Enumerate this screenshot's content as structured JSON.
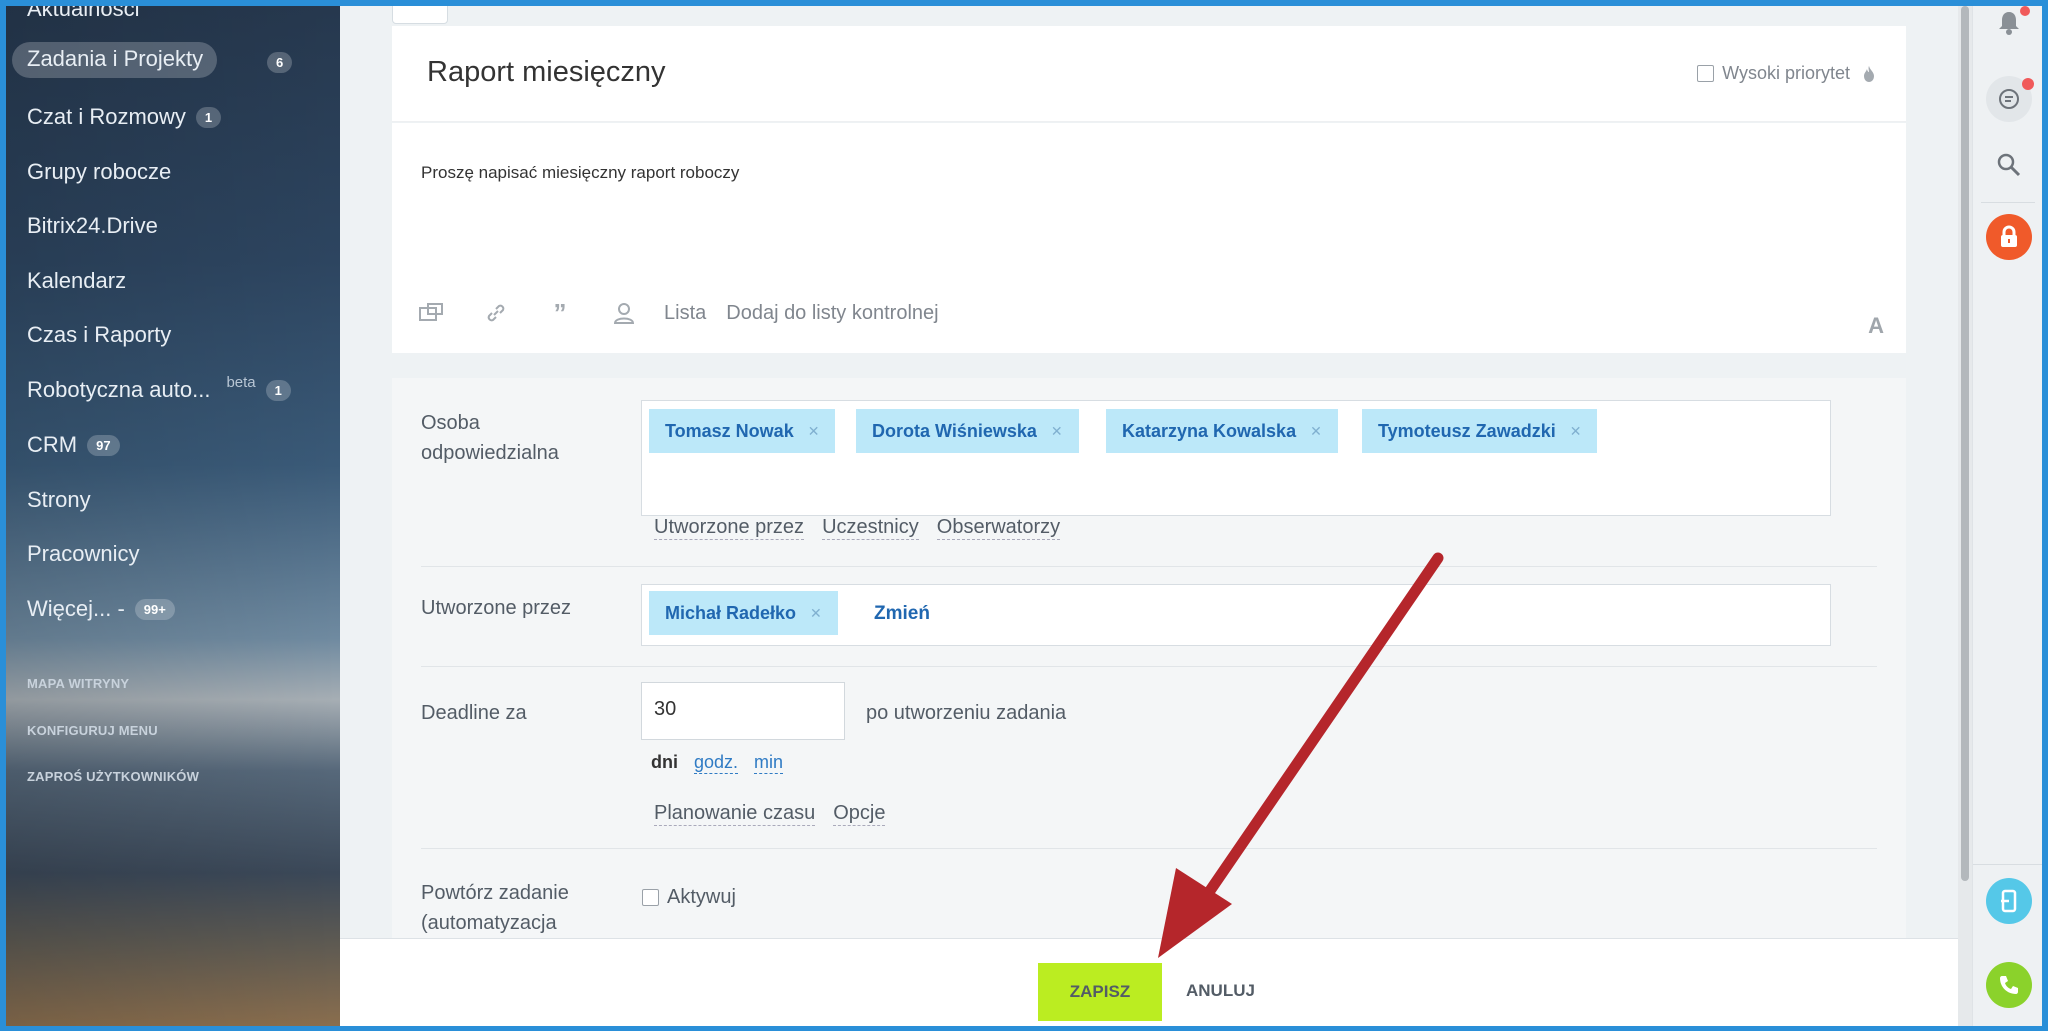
{
  "sidebar": {
    "items": [
      {
        "label": "Aktualności",
        "badge": ""
      },
      {
        "label": "Zadania i Projekty",
        "badge": "6"
      },
      {
        "label": "Czat i Rozmowy",
        "badge": "1"
      },
      {
        "label": "Grupy robocze",
        "badge": ""
      },
      {
        "label": "Bitrix24.Drive",
        "badge": ""
      },
      {
        "label": "Kalendarz",
        "badge": ""
      },
      {
        "label": "Czas i Raporty",
        "badge": ""
      },
      {
        "label": "Robotyczna auto...",
        "beta": "beta",
        "badge": "1"
      },
      {
        "label": "CRM",
        "badge": "97"
      },
      {
        "label": "Strony",
        "badge": ""
      },
      {
        "label": "Pracownicy",
        "badge": ""
      },
      {
        "label": "Więcej... -",
        "badge": "99+"
      }
    ],
    "small": [
      "MAPA WITRYNY",
      "KONFIGURUJ MENU",
      "ZAPROŚ UŻYTKOWNIKÓW"
    ]
  },
  "task": {
    "title": "Raport miesięczny",
    "priority_label": "Wysoki priorytet",
    "description": "Proszę napisać miesięczny raport roboczy",
    "toolbar": {
      "list": "Lista",
      "checklist": "Dodaj do listy kontrolnej",
      "font": "A"
    }
  },
  "form": {
    "responsible": {
      "label1": "Osoba",
      "label2": "odpowiedzialna",
      "tags": [
        "Tomasz Nowak",
        "Dorota Wiśniewska",
        "Katarzyna Kowalska",
        "Tymoteusz Zawadzki"
      ],
      "links": [
        "Utworzone przez",
        "Uczestnicy",
        "Obserwatorzy"
      ]
    },
    "created_by": {
      "label": "Utworzone przez",
      "tag": "Michał Radełko",
      "change": "Zmień"
    },
    "deadline": {
      "label": "Deadline za",
      "value": "30",
      "after": "po utworzeniu zadania",
      "units": {
        "active": "dni",
        "hours": "godz.",
        "minutes": "min"
      },
      "links": [
        "Planowanie czasu",
        "Opcje"
      ]
    },
    "repeat": {
      "label1": "Powtórz zadanie",
      "label2": "(automatyzacja",
      "activate": "Aktywuj"
    }
  },
  "footer": {
    "save": "ZAPISZ",
    "cancel": "ANULUJ"
  },
  "colors": {
    "save_bg": "#bbed21",
    "tag_bg": "#bce8f9",
    "arrow": "#b5262b",
    "lock": "#f05a2a",
    "phone": "#8bd22b",
    "mobile": "#55c8e8"
  },
  "icons": [
    "bell-icon",
    "chat-icon",
    "search-icon",
    "lock-icon",
    "mobile-icon",
    "phone-icon",
    "flame-icon"
  ]
}
